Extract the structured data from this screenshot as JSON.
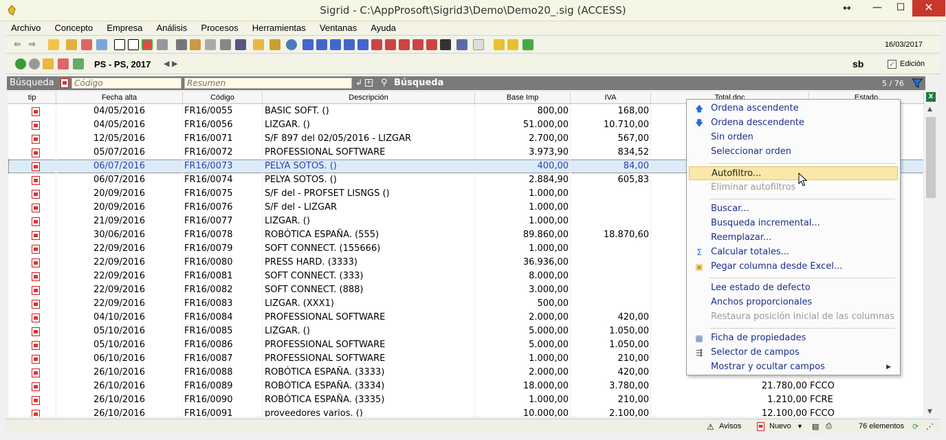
{
  "window": {
    "title": "Sigrid - C:\\AppProsoft\\Sigrid3\\Demo\\Demo20_.sig (ACCESS)",
    "resize_glyph": "↔",
    "min_glyph": "—",
    "max_glyph": "☐",
    "close_glyph": "✕"
  },
  "menu": [
    "Archivo",
    "Concepto",
    "Empresa",
    "Análisis",
    "Procesos",
    "Herramientas",
    "Ventanas",
    "Ayuda"
  ],
  "toolbar": {
    "date": "16/03/2017"
  },
  "context_bar": {
    "label": "PS - PS, 2017",
    "user": "sb",
    "edicion_label": "Edición",
    "edicion_checked": true
  },
  "search": {
    "label": "Búsqueda",
    "codigo_placeholder": "Código",
    "resumen_placeholder": "Resumen",
    "panel_title": "Búsqueda",
    "count": "5 / 76"
  },
  "columns": [
    "tip",
    "Fecha alta",
    "Código",
    "Descripción",
    "Base Imp",
    "IVA",
    "Total doc",
    "Estado"
  ],
  "rows": [
    {
      "fecha": "04/05/2016",
      "codigo": "FR16/0055",
      "desc": "BASIC SOFT. ()",
      "base": "800,00",
      "iva": "168,00",
      "total": "",
      "estado": ""
    },
    {
      "fecha": "04/05/2016",
      "codigo": "FR16/0056",
      "desc": "LIZGAR. ()",
      "base": "51.000,00",
      "iva": "10.710,00",
      "total": "",
      "estado": ""
    },
    {
      "fecha": "12/05/2016",
      "codigo": "FR16/0071",
      "desc": "S/F 897 del 02/05/2016 - LIZGAR",
      "base": "2.700,00",
      "iva": "567,00",
      "total": "",
      "estado": ""
    },
    {
      "fecha": "05/07/2016",
      "codigo": "FR16/0072",
      "desc": "PROFESSIONAL SOFTWARE",
      "base": "3.973,90",
      "iva": "834,52",
      "total": "",
      "estado": ""
    },
    {
      "fecha": "06/07/2016",
      "codigo": "FR16/0073",
      "desc": "PELYA SOTOS. ()",
      "base": "400,00",
      "iva": "84,00",
      "total": "",
      "estado": "",
      "selected": true
    },
    {
      "fecha": "06/07/2016",
      "codigo": "FR16/0074",
      "desc": "PELYA SOTOS. ()",
      "base": "2.884,90",
      "iva": "605,83",
      "total": "",
      "estado": ""
    },
    {
      "fecha": "20/09/2016",
      "codigo": "FR16/0075",
      "desc": "S/F  del  - PROFSET LISNGS ()",
      "base": "1.000,00",
      "iva": "",
      "total": "",
      "estado": ""
    },
    {
      "fecha": "20/09/2016",
      "codigo": "FR16/0076",
      "desc": "S/F  del  - LIZGAR",
      "base": "1.000,00",
      "iva": "",
      "total": "",
      "estado": ""
    },
    {
      "fecha": "21/09/2016",
      "codigo": "FR16/0077",
      "desc": "LIZGAR. ()",
      "base": "1.000,00",
      "iva": "",
      "total": "",
      "estado": ""
    },
    {
      "fecha": "30/06/2016",
      "codigo": "FR16/0078",
      "desc": "ROBÓTICA ESPAÑA. (555)",
      "base": "89.860,00",
      "iva": "18.870,60",
      "total": "",
      "estado": ""
    },
    {
      "fecha": "22/09/2016",
      "codigo": "FR16/0079",
      "desc": "SOFT CONNECT. (155666)",
      "base": "1.000,00",
      "iva": "",
      "total": "",
      "estado": ""
    },
    {
      "fecha": "22/09/2016",
      "codigo": "FR16/0080",
      "desc": "PRESS HARD. (3333)",
      "base": "36.936,00",
      "iva": "",
      "total": "",
      "estado": ""
    },
    {
      "fecha": "22/09/2016",
      "codigo": "FR16/0081",
      "desc": "SOFT CONNECT. (333)",
      "base": "8.000,00",
      "iva": "",
      "total": "",
      "estado": ""
    },
    {
      "fecha": "22/09/2016",
      "codigo": "FR16/0082",
      "desc": "SOFT CONNECT. (888)",
      "base": "3.000,00",
      "iva": "",
      "total": "",
      "estado": ""
    },
    {
      "fecha": "22/09/2016",
      "codigo": "FR16/0083",
      "desc": "LIZGAR. (XXX1)",
      "base": "500,00",
      "iva": "",
      "total": "",
      "estado": ""
    },
    {
      "fecha": "04/10/2016",
      "codigo": "FR16/0084",
      "desc": "PROFESSIONAL SOFTWARE",
      "base": "2.000,00",
      "iva": "420,00",
      "total": "",
      "estado": ""
    },
    {
      "fecha": "05/10/2016",
      "codigo": "FR16/0085",
      "desc": "LIZGAR. ()",
      "base": "5.000,00",
      "iva": "1.050,00",
      "total": "",
      "estado": ""
    },
    {
      "fecha": "05/10/2016",
      "codigo": "FR16/0086",
      "desc": "PROFESSIONAL SOFTWARE",
      "base": "5.000,00",
      "iva": "1.050,00",
      "total": "",
      "estado": ""
    },
    {
      "fecha": "06/10/2016",
      "codigo": "FR16/0087",
      "desc": "PROFESSIONAL SOFTWARE",
      "base": "1.000,00",
      "iva": "210,00",
      "total": "",
      "estado": ""
    },
    {
      "fecha": "26/10/2016",
      "codigo": "FR16/0088",
      "desc": "ROBÓTICA ESPAÑA. (3333)",
      "base": "2.000,00",
      "iva": "420,00",
      "total": "",
      "estado": ""
    },
    {
      "fecha": "26/10/2016",
      "codigo": "FR16/0089",
      "desc": "ROBÓTICA ESPAÑA. (3334)",
      "base": "18.000,00",
      "iva": "3.780,00",
      "total": "21.780,00",
      "estado": "FCCO"
    },
    {
      "fecha": "26/10/2016",
      "codigo": "FR16/0090",
      "desc": "ROBÓTICA ESPAÑA. (3335)",
      "base": "1.000,00",
      "iva": "210,00",
      "total": "1.210,00",
      "estado": "FCRE"
    },
    {
      "fecha": "26/10/2016",
      "codigo": "FR16/0091",
      "desc": "proveedores varios. ()",
      "base": "10.000,00",
      "iva": "2.100,00",
      "total": "12.100,00",
      "estado": "FCCO"
    }
  ],
  "context_menu": [
    {
      "label": "Ordena ascendente",
      "icon": "arrow-up-icon"
    },
    {
      "label": "Ordena descendente",
      "icon": "arrow-down-icon"
    },
    {
      "label": "Sin orden"
    },
    {
      "label": "Seleccionar orden"
    },
    {
      "separator": true
    },
    {
      "label": "Autofiltro...",
      "highlighted": true
    },
    {
      "label": "Eliminar autofiltros",
      "disabled": true
    },
    {
      "separator": true
    },
    {
      "label": "Buscar..."
    },
    {
      "label": "Busqueda incremental..."
    },
    {
      "label": "Reemplazar..."
    },
    {
      "label": "Calcular totales...",
      "icon": "sigma-icon"
    },
    {
      "label": "Pegar columna desde Excel...",
      "icon": "paste-icon"
    },
    {
      "separator": true
    },
    {
      "label": "Lee estado de defecto"
    },
    {
      "label": "Anchos proporcionales"
    },
    {
      "label": "Restaura posición inicial de las columnas",
      "disabled": true
    },
    {
      "separator": true
    },
    {
      "label": "Ficha de propiedades",
      "icon": "properties-icon"
    },
    {
      "label": "Selector de campos",
      "icon": "field-selector-icon"
    },
    {
      "label": "Mostrar y ocultar campos",
      "submenu": true
    }
  ],
  "status": {
    "avisos": "Avisos",
    "nuevo": "Nuevo",
    "elementos": "76 elementos"
  },
  "colors": {
    "title_bg": "#f6f6e4",
    "close_red": "#c7372b",
    "search_bar": "#7a7a7a",
    "selected_row": "#dcebf7",
    "menu_text": "#1a2f8f",
    "menu_highlight": "#fbe7a6"
  }
}
